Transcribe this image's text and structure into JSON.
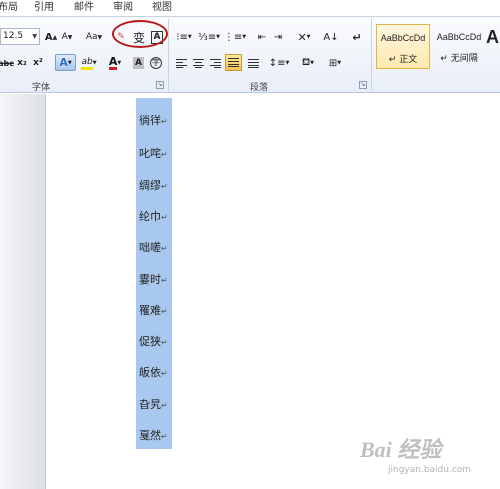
{
  "menu": {
    "tabs": [
      "布局",
      "引用",
      "邮件",
      "审阅",
      "视图"
    ]
  },
  "font_group": {
    "label": "字体",
    "font_size": "12.5",
    "grow_label": "A",
    "shrink_label": "A",
    "change_case_label": "Aa",
    "clear_format_label": "A",
    "phonetic_label": "变",
    "char_border_label": "A",
    "strike_label": "abc",
    "subscript_label": "x₂",
    "superscript_label": "x²",
    "text_effect_label": "A",
    "highlight_label": "ab",
    "font_color_label": "A",
    "char_shading_label": "A",
    "enclose_label": "字"
  },
  "paragraph_group": {
    "label": "段落"
  },
  "styles": [
    {
      "sample": "AaBbCcDd",
      "name": "正文",
      "selected": true
    },
    {
      "sample": "AaBbCcDd",
      "name": "无间隔",
      "selected": false
    },
    {
      "sample": "A",
      "name": "",
      "selected": false
    }
  ],
  "document": {
    "lines": [
      "徜徉",
      "叱咤",
      "绸缪",
      "纶巾",
      "咄嗟",
      "霎时",
      "罹难",
      "促狭",
      "皈依",
      "旮旯",
      "戛然"
    ],
    "paragraph_mark": "↵"
  },
  "watermark": {
    "text": "Bai 经验",
    "sub": "jingyan.baidu.com"
  },
  "colors": {
    "selection": "#a8c8ef",
    "annotation_ellipse": "#b81a1a",
    "highlight_yellow": "#f2e300",
    "font_red": "#d21f1f"
  }
}
